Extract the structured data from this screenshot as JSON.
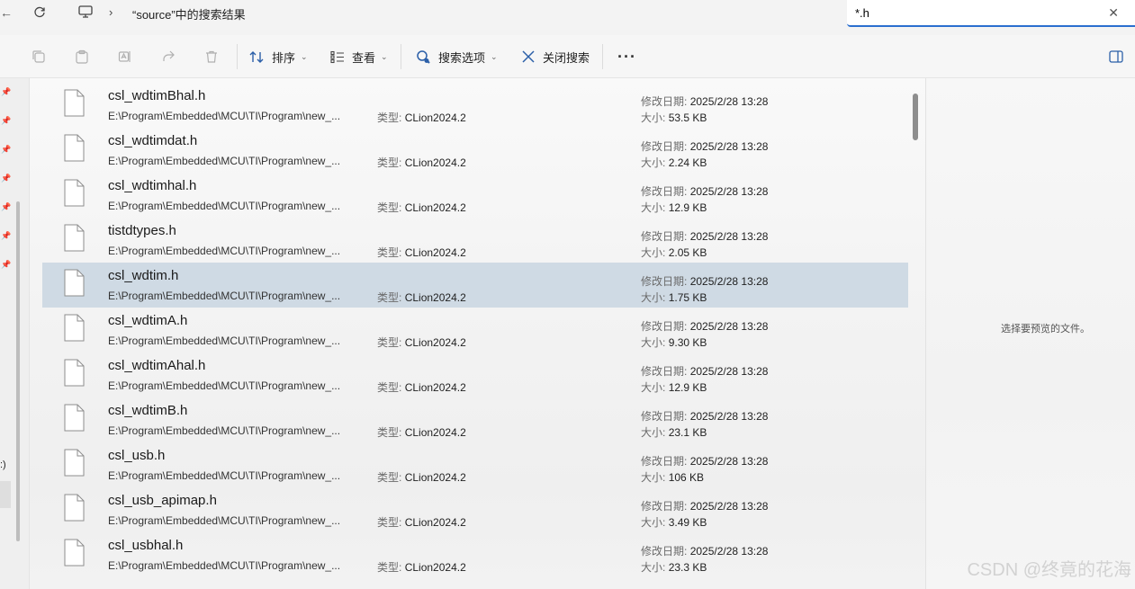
{
  "addressbar": {
    "back_glyph": "←",
    "title": "“source”中的搜索结果",
    "breadcrumb_sep": "›"
  },
  "search": {
    "value": "*.h"
  },
  "toolbar": {
    "sort_label": "排序",
    "view_label": "查看",
    "search_options_label": "搜索选项",
    "close_search_label": "关闭搜索",
    "more_label": "···"
  },
  "nav": {
    "fragment": ":)"
  },
  "labels": {
    "type": "类型:",
    "modified": "修改日期:",
    "size": "大小:"
  },
  "files": [
    {
      "name": "csl_wdtimBhal.h",
      "path": "E:\\Program\\Embedded\\MCU\\TI\\Program\\new_...",
      "type": "CLion2024.2",
      "modified": "2025/2/28 13:28",
      "size": "53.5 KB",
      "selected": false
    },
    {
      "name": "csl_wdtimdat.h",
      "path": "E:\\Program\\Embedded\\MCU\\TI\\Program\\new_...",
      "type": "CLion2024.2",
      "modified": "2025/2/28 13:28",
      "size": "2.24 KB",
      "selected": false
    },
    {
      "name": "csl_wdtimhal.h",
      "path": "E:\\Program\\Embedded\\MCU\\TI\\Program\\new_...",
      "type": "CLion2024.2",
      "modified": "2025/2/28 13:28",
      "size": "12.9 KB",
      "selected": false
    },
    {
      "name": "tistdtypes.h",
      "path": "E:\\Program\\Embedded\\MCU\\TI\\Program\\new_...",
      "type": "CLion2024.2",
      "modified": "2025/2/28 13:28",
      "size": "2.05 KB",
      "selected": false
    },
    {
      "name": "csl_wdtim.h",
      "path": "E:\\Program\\Embedded\\MCU\\TI\\Program\\new_...",
      "type": "CLion2024.2",
      "modified": "2025/2/28 13:28",
      "size": "1.75 KB",
      "selected": true
    },
    {
      "name": "csl_wdtimA.h",
      "path": "E:\\Program\\Embedded\\MCU\\TI\\Program\\new_...",
      "type": "CLion2024.2",
      "modified": "2025/2/28 13:28",
      "size": "9.30 KB",
      "selected": false
    },
    {
      "name": "csl_wdtimAhal.h",
      "path": "E:\\Program\\Embedded\\MCU\\TI\\Program\\new_...",
      "type": "CLion2024.2",
      "modified": "2025/2/28 13:28",
      "size": "12.9 KB",
      "selected": false
    },
    {
      "name": "csl_wdtimB.h",
      "path": "E:\\Program\\Embedded\\MCU\\TI\\Program\\new_...",
      "type": "CLion2024.2",
      "modified": "2025/2/28 13:28",
      "size": "23.1 KB",
      "selected": false
    },
    {
      "name": "csl_usb.h",
      "path": "E:\\Program\\Embedded\\MCU\\TI\\Program\\new_...",
      "type": "CLion2024.2",
      "modified": "2025/2/28 13:28",
      "size": "106 KB",
      "selected": false
    },
    {
      "name": "csl_usb_apimap.h",
      "path": "E:\\Program\\Embedded\\MCU\\TI\\Program\\new_...",
      "type": "CLion2024.2",
      "modified": "2025/2/28 13:28",
      "size": "3.49 KB",
      "selected": false
    },
    {
      "name": "csl_usbhal.h",
      "path": "E:\\Program\\Embedded\\MCU\\TI\\Program\\new_...",
      "type": "CLion2024.2",
      "modified": "2025/2/28 13:28",
      "size": "23.3 KB",
      "selected": false
    }
  ],
  "preview": {
    "message": "选择要预览的文件。"
  },
  "watermark": "CSDN @终竟的花海",
  "colors": {
    "accent": "#2b6fcf",
    "selection": "#cfdae4"
  }
}
